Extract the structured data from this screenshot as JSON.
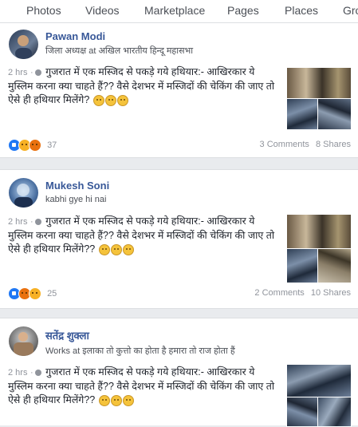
{
  "nav": {
    "tabs": [
      "Photos",
      "Videos",
      "Marketplace",
      "Pages",
      "Places",
      "Gro"
    ]
  },
  "posts": [
    {
      "author": "Pawan Modi",
      "subtitle": "जिला अध्यक्ष at अखिल भारतीय हिन्दू महासभा",
      "time": "2 hrs",
      "text": "गुजरात में एक मस्जिद से पकड़े गये हथियार:- आखिरकार ये मुस्लिम करना क्या चाहते हैं?? वैसे देशभर में मस्जिदों की चेकिंग की जाए तो ऐसे ही हथियार मिलेंगे?",
      "reaction_count": "37",
      "comments": "3 Comments",
      "shares": "8 Shares"
    },
    {
      "author": "Mukesh Soni",
      "subtitle": "kabhi gye hi nai",
      "time": "2 hrs",
      "text": "गुजरात में एक मस्जिद से पकड़े गये हथियार:- आखिरकार ये मुस्लिम करना क्या चाहते हैं?? वैसे देशभर में मस्जिदों की चेकिंग की जाए तो ऐसे ही हथियार मिलेंगे??",
      "reaction_count": "25",
      "comments": "2 Comments",
      "shares": "10 Shares"
    },
    {
      "author": "सतेंद्र शुक्ला",
      "subtitle": "Works at इलाका तो कुत्तो का होता है हमारा तो राज होता हैं",
      "time": "2 hrs",
      "text": "गुजरात में एक मस्जिद से पकड़े गये हथियार:- आखिरकार ये मुस्लिम करना क्या चाहते हैं?? वैसे देशभर में मस्जिदों की चेकिंग की जाए तो ऐसे ही हथियार मिलेंगे??"
    }
  ],
  "colors": {
    "link": "#385898",
    "meta": "#90949c",
    "like": "#2078f4",
    "angry": "#e9710f"
  }
}
